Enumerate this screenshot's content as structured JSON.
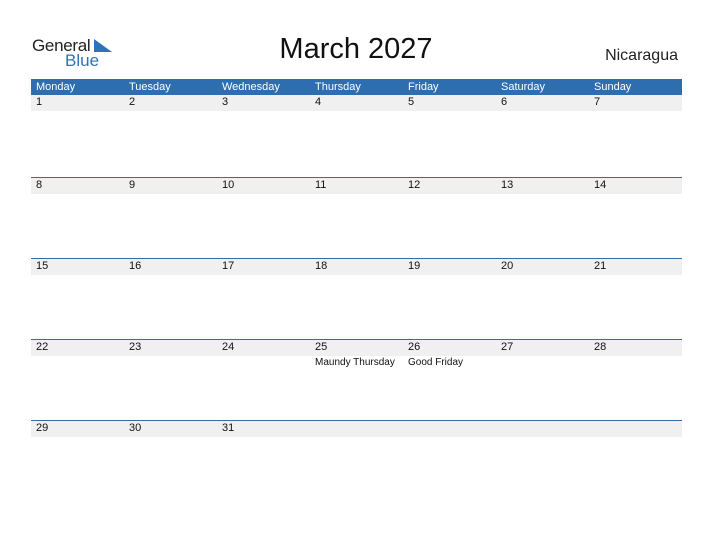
{
  "logo": {
    "word1": "General",
    "word2": "Blue"
  },
  "title": "March 2027",
  "country": "Nicaragua",
  "colors": {
    "header_bg": "#2e6db0",
    "date_row_bg": "#f0f0f0",
    "brand_blue": "#2e73b8"
  },
  "weekdays": [
    "Monday",
    "Tuesday",
    "Wednesday",
    "Thursday",
    "Friday",
    "Saturday",
    "Sunday"
  ],
  "weeks": [
    {
      "days": [
        "1",
        "2",
        "3",
        "4",
        "5",
        "6",
        "7"
      ],
      "events": [
        "",
        "",
        "",
        "",
        "",
        "",
        ""
      ]
    },
    {
      "days": [
        "8",
        "9",
        "10",
        "11",
        "12",
        "13",
        "14"
      ],
      "events": [
        "",
        "",
        "",
        "",
        "",
        "",
        ""
      ]
    },
    {
      "days": [
        "15",
        "16",
        "17",
        "18",
        "19",
        "20",
        "21"
      ],
      "events": [
        "",
        "",
        "",
        "",
        "",
        "",
        ""
      ]
    },
    {
      "days": [
        "22",
        "23",
        "24",
        "25",
        "26",
        "27",
        "28"
      ],
      "events": [
        "",
        "",
        "",
        "Maundy Thursday",
        "Good Friday",
        "",
        ""
      ]
    },
    {
      "days": [
        "29",
        "30",
        "31",
        "",
        "",
        "",
        ""
      ],
      "events": [
        "",
        "",
        "",
        "",
        "",
        "",
        ""
      ]
    }
  ]
}
